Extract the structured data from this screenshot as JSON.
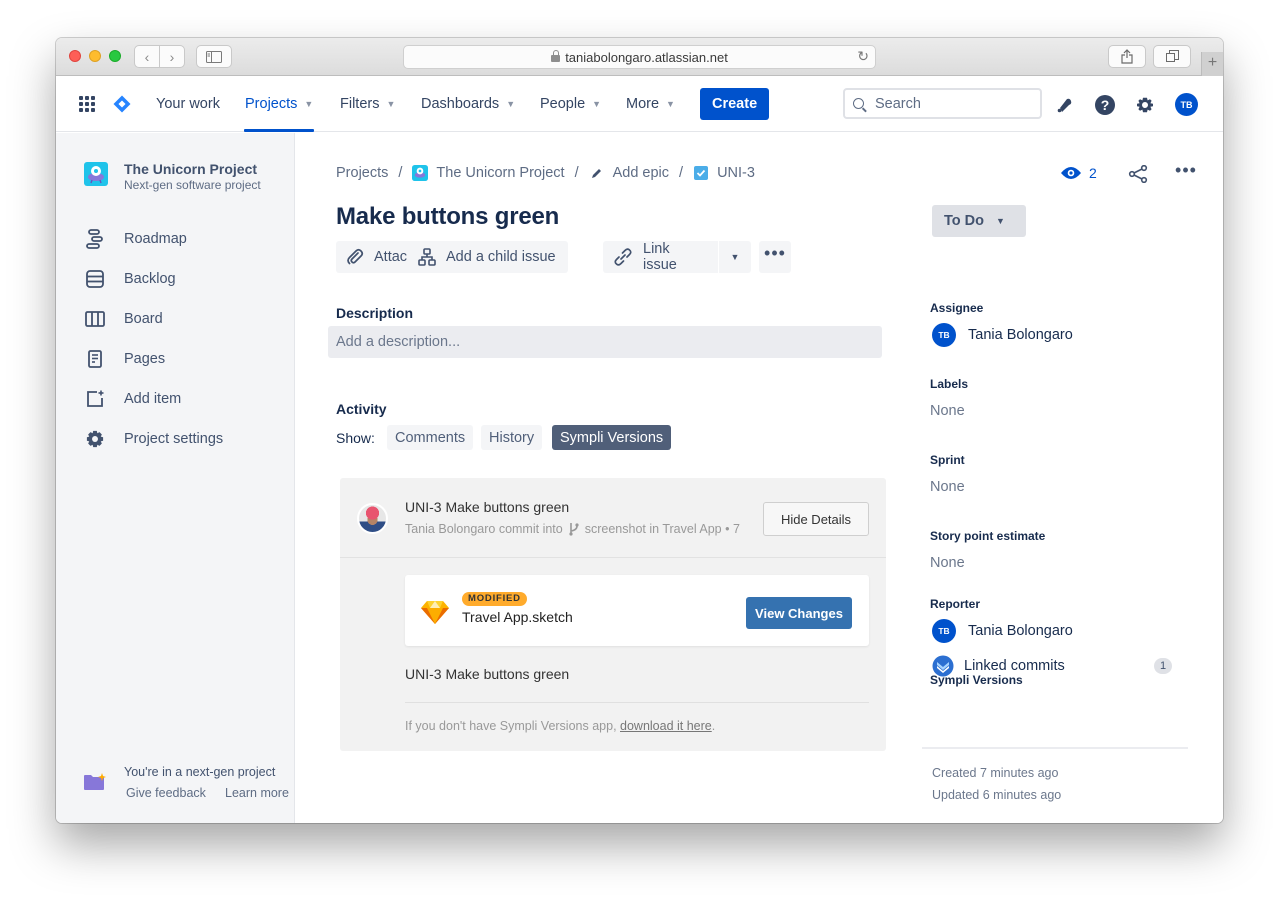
{
  "browser": {
    "url": "taniabolongaro.atlassian.net",
    "new_tab_label": "+"
  },
  "topnav": {
    "items": [
      {
        "label": "Your work",
        "has_dropdown": false,
        "active": false
      },
      {
        "label": "Projects",
        "has_dropdown": true,
        "active": true
      },
      {
        "label": "Filters",
        "has_dropdown": true,
        "active": false
      },
      {
        "label": "Dashboards",
        "has_dropdown": true,
        "active": false
      },
      {
        "label": "People",
        "has_dropdown": true,
        "active": false
      },
      {
        "label": "More",
        "has_dropdown": true,
        "active": false
      }
    ],
    "create_label": "Create",
    "search_placeholder": "Search",
    "user_initials": "TB",
    "icons": [
      "app-switcher-icon",
      "jira-logo",
      "notifications-icon",
      "help-icon",
      "settings-icon"
    ]
  },
  "sidebar": {
    "project_name": "The Unicorn Project",
    "project_type": "Next-gen software project",
    "items": [
      {
        "label": "Roadmap",
        "icon": "roadmap-icon"
      },
      {
        "label": "Backlog",
        "icon": "backlog-icon"
      },
      {
        "label": "Board",
        "icon": "board-icon"
      },
      {
        "label": "Pages",
        "icon": "pages-icon"
      },
      {
        "label": "Add item",
        "icon": "add-item-icon"
      },
      {
        "label": "Project settings",
        "icon": "settings-icon"
      }
    ],
    "footer": {
      "title": "You're in a next-gen project",
      "feedback_label": "Give feedback",
      "learn_label": "Learn more"
    }
  },
  "breadcrumbs": [
    {
      "label": "Projects"
    },
    {
      "label": "The Unicorn Project",
      "icon": "project-avatar-icon"
    },
    {
      "label": "Add epic",
      "icon": "pencil-icon"
    },
    {
      "label": "UNI-3",
      "icon": "task-checkbox-icon"
    }
  ],
  "issue": {
    "title": "Make buttons green",
    "actions": [
      {
        "label": "Attach",
        "icon": "paperclip-icon"
      },
      {
        "label": "Add a child issue",
        "icon": "child-issue-icon"
      },
      {
        "label": "Link issue",
        "icon": "link-icon"
      }
    ],
    "description_label": "Description",
    "description_placeholder": "Add a description...",
    "activity_label": "Activity",
    "show_label": "Show:",
    "activity_filters": [
      {
        "label": "Comments",
        "selected": false
      },
      {
        "label": "History",
        "selected": false
      },
      {
        "label": "Sympli Versions",
        "selected": true
      }
    ]
  },
  "sympli": {
    "commit_title": "UNI-3 Make buttons green",
    "commit_author": "Tania Bolongaro commit into",
    "commit_branch": "screenshot in Travel App • 7",
    "hide_details_label": "Hide Details",
    "file": {
      "status_badge": "MODIFIED",
      "name": "Travel App.sketch",
      "view_changes_label": "View Changes"
    },
    "commit_message": "UNI-3 Make buttons green",
    "footnote_prefix": "If you don't have Sympli Versions app, ",
    "footnote_link": "download it here",
    "footnote_suffix": "."
  },
  "details": {
    "watchers": "2",
    "status": "To Do",
    "fields": {
      "assignee_label": "Assignee",
      "assignee_name": "Tania Bolongaro",
      "assignee_initials": "TB",
      "labels_label": "Labels",
      "labels_value": "None",
      "sprint_label": "Sprint",
      "sprint_value": "None",
      "story_points_label": "Story point estimate",
      "story_points_value": "None",
      "reporter_label": "Reporter",
      "reporter_name": "Tania Bolongaro",
      "reporter_initials": "TB",
      "sympli_label": "Sympli Versions",
      "linked_commits_label": "Linked commits",
      "linked_commits_count": "1"
    },
    "created": "Created 7 minutes ago",
    "updated": "Updated 6 minutes ago"
  },
  "colors": {
    "brand_blue": "#0052cc",
    "sympli_button": "#3572b0",
    "modified_badge": "#ffab2c",
    "selected_filter": "#505f79"
  }
}
